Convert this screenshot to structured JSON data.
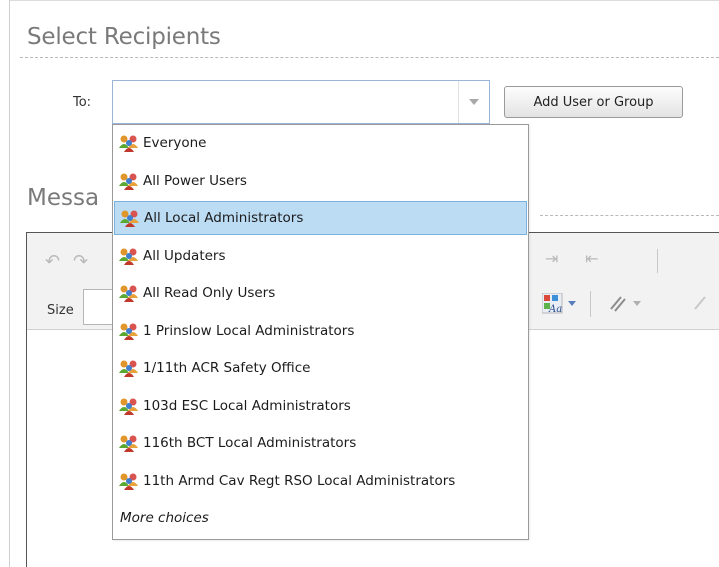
{
  "recipients": {
    "title": "Select Recipients",
    "to_label": "To:",
    "to_value": "",
    "add_button_label": "Add User or Group"
  },
  "message": {
    "title_visible": "Messa"
  },
  "editor": {
    "size_label": "Size"
  },
  "dropdown": {
    "items": [
      {
        "label": "Everyone",
        "icon": "group-icon"
      },
      {
        "label": "All Power Users",
        "icon": "group-icon"
      },
      {
        "label": "All Local Administrators",
        "icon": "group-icon",
        "selected": true
      },
      {
        "label": "All Updaters",
        "icon": "group-icon"
      },
      {
        "label": "All Read Only Users",
        "icon": "group-icon"
      },
      {
        "label": "1 Prinslow Local Administrators",
        "icon": "group-icon"
      },
      {
        "label": "1/11th ACR Safety Office",
        "icon": "group-icon"
      },
      {
        "label": "103d ESC Local Administrators",
        "icon": "group-icon"
      },
      {
        "label": "116th BCT Local Administrators",
        "icon": "group-icon"
      },
      {
        "label": "11th Armd Cav Regt RSO Local Administrators",
        "icon": "group-icon"
      }
    ],
    "more_label": "More choices"
  },
  "colors": {
    "selected_bg": "#bcdcf4",
    "selected_border": "#7bb2dd",
    "title_gray": "#7a7a7a"
  }
}
